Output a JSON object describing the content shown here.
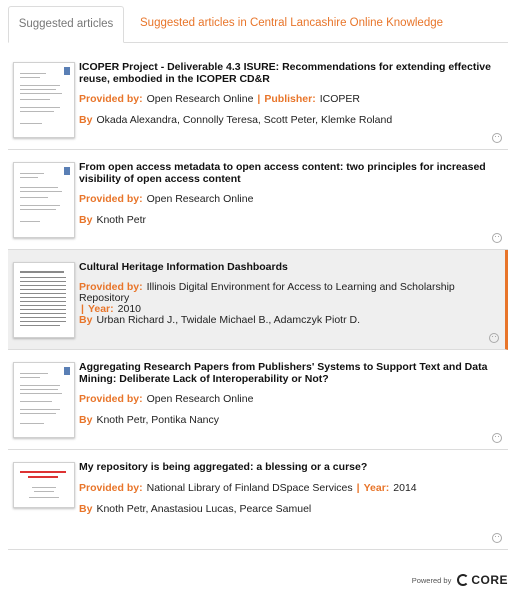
{
  "tabs": {
    "suggested": "Suggested articles",
    "repo": "Suggested articles in Central Lancashire Online Knowledge"
  },
  "labels": {
    "provided_by": "Provided by:",
    "publisher": "Publisher:",
    "year": "Year:",
    "by": "By",
    "separator": "|"
  },
  "articles": [
    {
      "title": "ICOPER Project - Deliverable 4.3 ISURE: Recommendations for extending effective reuse, embodied in the ICOPER CD&R",
      "provided_by": "Open Research Online",
      "publisher": "ICOPER",
      "authors": "Okada Alexandra, Connolly Teresa, Scott Peter, Klemke Roland"
    },
    {
      "title": "From open access metadata to open access content: two principles for increased visibility of open access content",
      "provided_by": "Open Research Online",
      "authors": "Knoth Petr"
    },
    {
      "title": "Cultural Heritage Information Dashboards",
      "provided_by": "Illinois Digital Environment for Access to Learning and Scholarship Repository",
      "year": "2010",
      "authors": "Urban Richard J., Twidale Michael B., Adamczyk Piotr D."
    },
    {
      "title": "Aggregating Research Papers from Publishers' Systems to Support Text and Data Mining: Deliberate Lack of Interoperability or Not?",
      "provided_by": "Open Research Online",
      "authors": "Knoth Petr, Pontika Nancy"
    },
    {
      "title": "My repository is being aggregated: a blessing or a curse?",
      "provided_by": "National Library of Finland DSpace Services",
      "year": "2014",
      "authors": "Knoth Petr, Anastasiou Lucas, Pearce Samuel"
    }
  ],
  "footer": {
    "powered_by": "Powered by",
    "brand": "CORE"
  },
  "colors": {
    "accent": "#e8752a",
    "highlight_bg": "#efefef"
  }
}
